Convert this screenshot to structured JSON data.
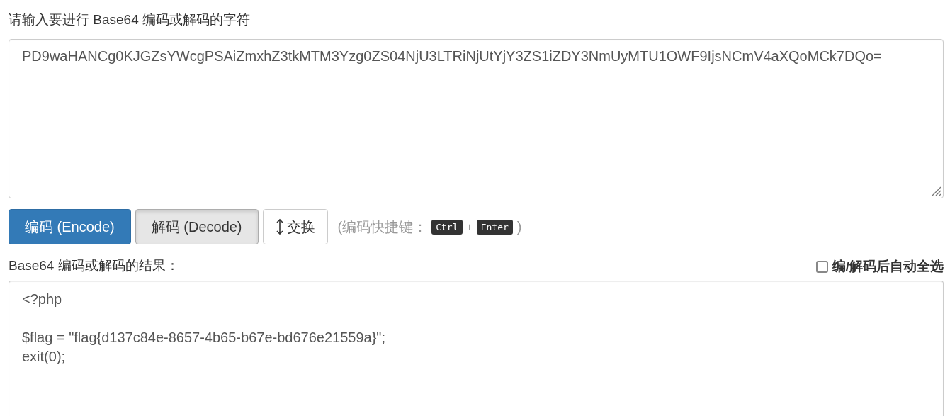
{
  "input_label": "请输入要进行 Base64 编码或解码的字符",
  "input": {
    "value": "PD9waHANCg0KJGZsYWcgPSAiZmxhZ3tkMTM3Yzg0ZS04NjU3LTRiNjUtYjY3ZS1iZDY3NmUyMTU1OWF9IjsNCmV4aXQoMCk7DQo="
  },
  "buttons": [
    {
      "kind": "primary",
      "label": "编码 (Encode)"
    },
    {
      "kind": "pressed",
      "label": "解码 (Decode)"
    },
    {
      "kind": "swap",
      "label": "交换"
    }
  ],
  "shortcut": {
    "prefix": "(编码快捷键：",
    "keys": [
      "Ctrl",
      "Enter"
    ],
    "separator": "+",
    "suffix": ")"
  },
  "output_label": "Base64 编码或解码的结果：",
  "auto_select": {
    "label": "编/解码后自动全选",
    "checked": false
  },
  "output": {
    "value": "<?php\n\n$flag = \"flag{d137c84e-8657-4b65-b67e-bd676e21559a}\";\nexit(0);"
  }
}
